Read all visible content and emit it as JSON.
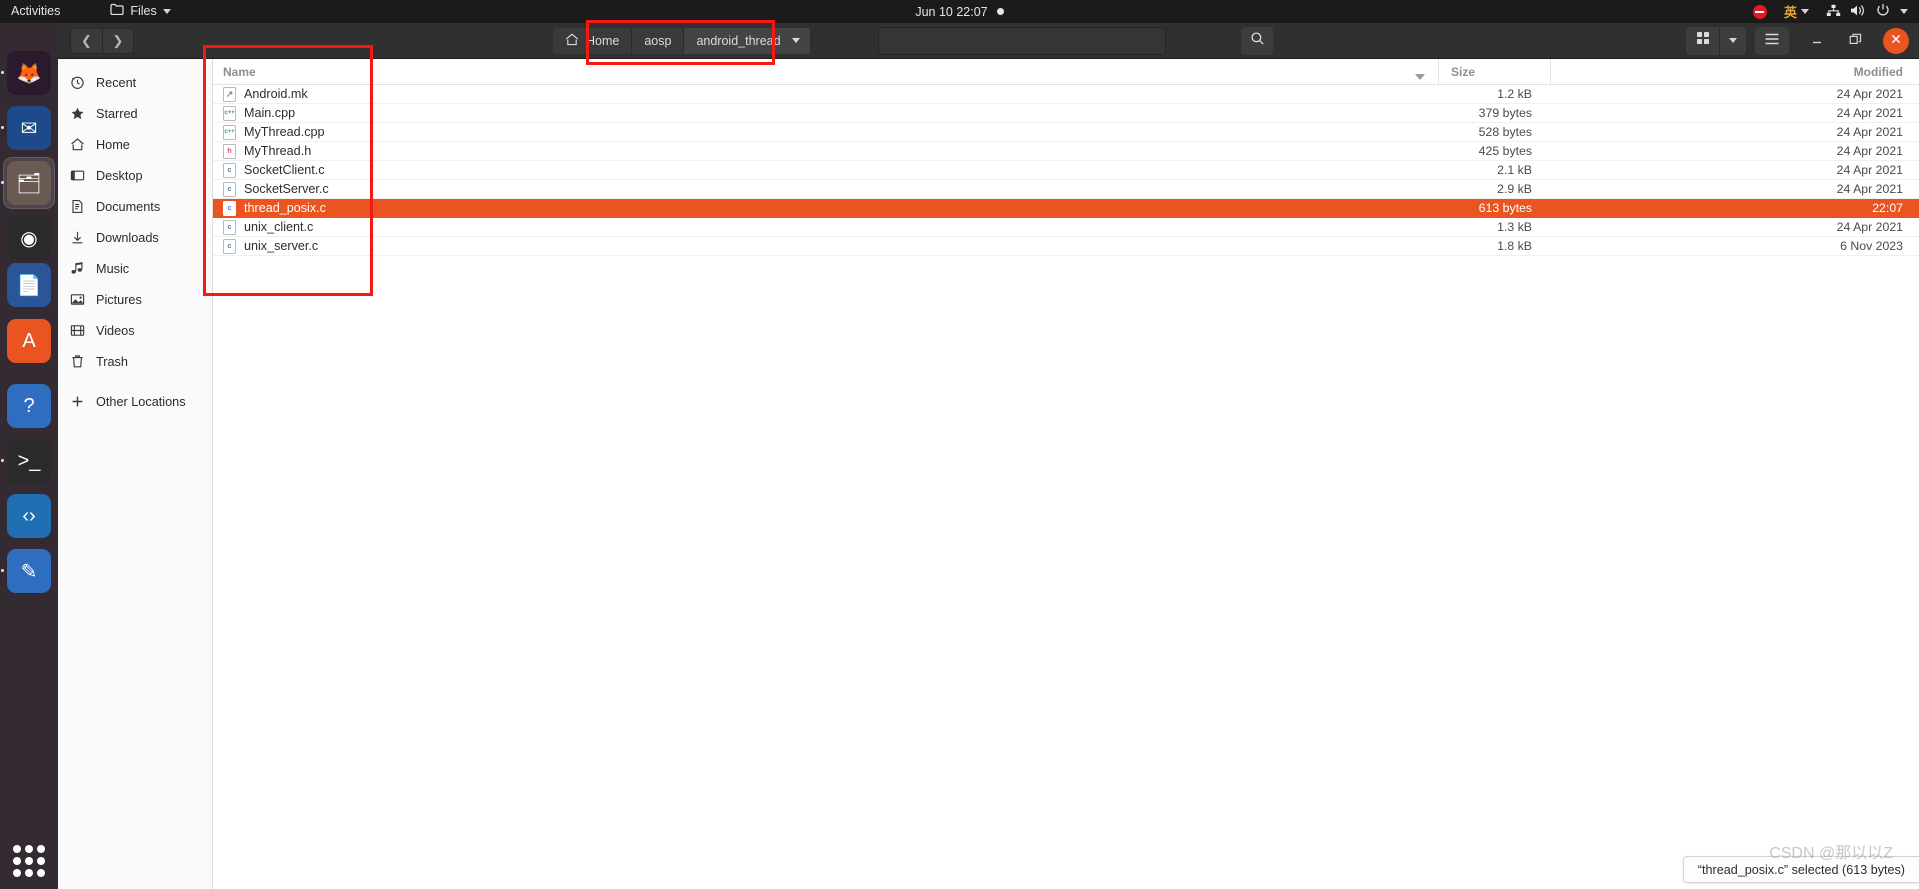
{
  "topbar": {
    "activities": "Activities",
    "app_menu": "Files",
    "clock": "Jun 10  22:07",
    "tray": {
      "do_not_disturb_icon": "no-entry-icon",
      "ime_label": "英",
      "network_icon": "network-icon",
      "volume_icon": "volume-icon",
      "power_icon": "power-icon"
    }
  },
  "dock": {
    "items": [
      {
        "name": "firefox",
        "glyph": "🦊",
        "bg": "#2b1a2e",
        "running": true
      },
      {
        "name": "thunderbird",
        "glyph": "✉",
        "bg": "#1c4a8a",
        "running": true
      },
      {
        "name": "files",
        "glyph": "🗂",
        "bg": "#6b5a52",
        "running": true,
        "active": true
      },
      {
        "name": "rhythmbox",
        "glyph": "◉",
        "bg": "#2a2a2a",
        "running": false
      },
      {
        "name": "libreoffice-writer",
        "glyph": "📄",
        "bg": "#2a5699",
        "running": false
      },
      {
        "name": "ubuntu-software",
        "glyph": "A",
        "bg": "#e95420",
        "running": false
      },
      {
        "name": "help",
        "glyph": "?",
        "bg": "#2f6dc0",
        "running": false
      },
      {
        "name": "terminal",
        "glyph": ">_",
        "bg": "#2a2a2a",
        "running": true
      },
      {
        "name": "vscode",
        "glyph": "‹›",
        "bg": "#1f6fb2",
        "running": false
      },
      {
        "name": "text-editor",
        "glyph": "✎",
        "bg": "#2f6dc0",
        "running": true
      }
    ],
    "show_apps_label": "Show Applications"
  },
  "window": {
    "nav": {
      "back_label": "Back",
      "forward_label": "Forward"
    },
    "pathbar": {
      "crumbs": [
        {
          "label": "Home",
          "icon": "home-icon",
          "current": false
        },
        {
          "label": "aosp",
          "icon": "",
          "current": false
        },
        {
          "label": "android_thread",
          "icon": "",
          "current": true
        }
      ]
    },
    "search_placeholder": "",
    "search_value": "",
    "buttons": {
      "search": "search-icon",
      "view_grid": "grid-view-icon",
      "view_caret": "chevron-down-icon",
      "menu": "hamburger-menu-icon",
      "minimize": "minimize-icon",
      "maximize": "maximize-icon",
      "close": "close-icon"
    }
  },
  "sidebar": {
    "items": [
      {
        "label": "Recent",
        "icon": "clock-icon"
      },
      {
        "label": "Starred",
        "icon": "star-icon"
      },
      {
        "label": "Home",
        "icon": "home-icon"
      },
      {
        "label": "Desktop",
        "icon": "desktop-icon"
      },
      {
        "label": "Documents",
        "icon": "document-icon"
      },
      {
        "label": "Downloads",
        "icon": "download-icon"
      },
      {
        "label": "Music",
        "icon": "music-note-icon"
      },
      {
        "label": "Pictures",
        "icon": "picture-icon"
      },
      {
        "label": "Videos",
        "icon": "film-icon"
      },
      {
        "label": "Trash",
        "icon": "trash-icon"
      },
      {
        "label": "Other Locations",
        "icon": "plus-icon"
      }
    ]
  },
  "filelist": {
    "columns": {
      "name": "Name",
      "size": "Size",
      "modified": "Modified"
    },
    "rows": [
      {
        "name": "Android.mk",
        "type": "mk",
        "size": "1.2 kB",
        "modified": "24 Apr 2021",
        "selected": false
      },
      {
        "name": "Main.cpp",
        "type": "cpp",
        "size": "379 bytes",
        "modified": "24 Apr 2021",
        "selected": false
      },
      {
        "name": "MyThread.cpp",
        "type": "cpp",
        "size": "528 bytes",
        "modified": "24 Apr 2021",
        "selected": false
      },
      {
        "name": "MyThread.h",
        "type": "h",
        "size": "425 bytes",
        "modified": "24 Apr 2021",
        "selected": false
      },
      {
        "name": "SocketClient.c",
        "type": "c",
        "size": "2.1 kB",
        "modified": "24 Apr 2021",
        "selected": false
      },
      {
        "name": "SocketServer.c",
        "type": "c",
        "size": "2.9 kB",
        "modified": "24 Apr 2021",
        "selected": false
      },
      {
        "name": "thread_posix.c",
        "type": "c",
        "size": "613 bytes",
        "modified": "22:07",
        "selected": true
      },
      {
        "name": "unix_client.c",
        "type": "c",
        "size": "1.3 kB",
        "modified": "24 Apr 2021",
        "selected": false
      },
      {
        "name": "unix_server.c",
        "type": "c",
        "size": "1.8 kB",
        "modified": "6 Nov 2023",
        "selected": false
      }
    ]
  },
  "status": {
    "text": "“thread_posix.c” selected (613 bytes)"
  },
  "watermark": {
    "text": "CSDN @那以以Z"
  },
  "icon_labels": {
    "mk": "↗",
    "cpp": "c++",
    "h": "h",
    "c": "c"
  },
  "colors": {
    "accent": "#e95420",
    "annotation": "#f41a12",
    "headerbar": "#303030"
  }
}
